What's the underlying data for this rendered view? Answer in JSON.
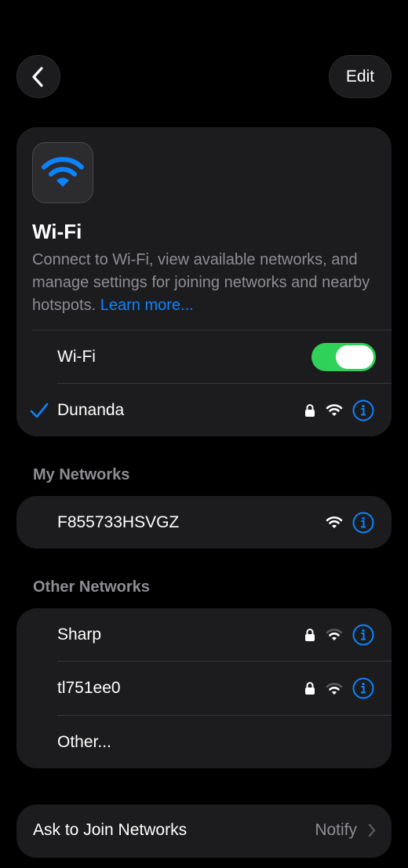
{
  "nav": {
    "edit_label": "Edit"
  },
  "header": {
    "title": "Wi-Fi",
    "description": "Connect to Wi-Fi, view available networks, and manage settings for joining networks and nearby hotspots.",
    "learn_more": "Learn more..."
  },
  "wifi_toggle": {
    "label": "Wi-Fi",
    "on": true
  },
  "connected_network": {
    "name": "Dunanda",
    "secured": true
  },
  "my_networks": {
    "heading": "My Networks",
    "items": [
      {
        "name": "F855733HSVGZ",
        "secured": false
      }
    ]
  },
  "other_networks": {
    "heading": "Other Networks",
    "items": [
      {
        "name": "Sharp",
        "secured": true
      },
      {
        "name": "tl751ee0",
        "secured": true
      }
    ],
    "other_label": "Other..."
  },
  "ask_to_join": {
    "label": "Ask to Join Networks",
    "value": "Notify"
  },
  "colors": {
    "accent": "#0a84ff",
    "toggle_on": "#30d158",
    "card_bg": "#1c1c1e",
    "secondary_text": "#8d8d93"
  },
  "icons": [
    "back-chevron-icon",
    "wifi-icon",
    "checkmark-icon",
    "lock-icon",
    "info-icon",
    "chevron-right-icon"
  ]
}
